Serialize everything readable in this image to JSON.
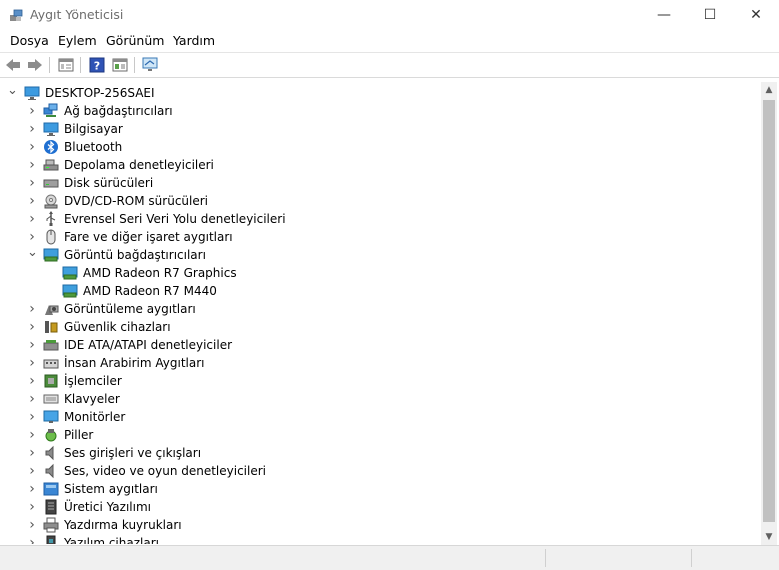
{
  "window": {
    "title": "Aygıt Yöneticisi",
    "controls": {
      "minimize": "—",
      "maximize": "☐",
      "close": "✕"
    }
  },
  "menu": [
    "Dosya",
    "Eylem",
    "Görünüm",
    "Yardım"
  ],
  "toolbar": {
    "icons": [
      "back-arrow-icon",
      "forward-arrow-icon",
      "properties-icon",
      "help-icon",
      "view-icon",
      "scan-monitor-icon"
    ]
  },
  "tree": {
    "root": "DESKTOP-256SAEI",
    "items": [
      {
        "label": "Ağ bağdaştırıcıları",
        "icon": "network-adapter-icon",
        "expanded": false
      },
      {
        "label": "Bilgisayar",
        "icon": "computer-icon",
        "expanded": false
      },
      {
        "label": "Bluetooth",
        "icon": "bluetooth-icon",
        "expanded": false
      },
      {
        "label": "Depolama denetleyicileri",
        "icon": "storage-controller-icon",
        "expanded": false
      },
      {
        "label": "Disk sürücüleri",
        "icon": "disk-drive-icon",
        "expanded": false
      },
      {
        "label": "DVD/CD-ROM sürücüleri",
        "icon": "dvd-drive-icon",
        "expanded": false
      },
      {
        "label": "Evrensel Seri Veri Yolu denetleyicileri",
        "icon": "usb-icon",
        "expanded": false
      },
      {
        "label": "Fare ve diğer işaret aygıtları",
        "icon": "mouse-icon",
        "expanded": false
      },
      {
        "label": "Görüntü bağdaştırıcıları",
        "icon": "display-adapter-icon",
        "expanded": true,
        "children": [
          {
            "label": "AMD Radeon R7 Graphics",
            "icon": "display-adapter-icon"
          },
          {
            "label": "AMD Radeon R7 M440",
            "icon": "display-adapter-icon"
          }
        ]
      },
      {
        "label": "Görüntüleme aygıtları",
        "icon": "imaging-device-icon",
        "expanded": false
      },
      {
        "label": "Güvenlik cihazları",
        "icon": "security-device-icon",
        "expanded": false
      },
      {
        "label": "IDE ATA/ATAPI denetleyiciler",
        "icon": "ide-controller-icon",
        "expanded": false
      },
      {
        "label": "İnsan Arabirim Aygıtları",
        "icon": "hid-icon",
        "expanded": false
      },
      {
        "label": "İşlemciler",
        "icon": "processor-icon",
        "expanded": false
      },
      {
        "label": "Klavyeler",
        "icon": "keyboard-icon",
        "expanded": false
      },
      {
        "label": "Monitörler",
        "icon": "monitor-icon",
        "expanded": false
      },
      {
        "label": "Piller",
        "icon": "battery-icon",
        "expanded": false
      },
      {
        "label": "Ses girişleri ve çıkışları",
        "icon": "speaker-icon",
        "expanded": false
      },
      {
        "label": "Ses, video ve oyun denetleyicileri",
        "icon": "speaker-icon",
        "expanded": false
      },
      {
        "label": "Sistem aygıtları",
        "icon": "system-device-icon",
        "expanded": false
      },
      {
        "label": "Üretici Yazılımı",
        "icon": "firmware-icon",
        "expanded": false
      },
      {
        "label": "Yazdırma kuyrukları",
        "icon": "printer-icon",
        "expanded": false
      },
      {
        "label": "Yazılım cihazları",
        "icon": "software-device-icon",
        "expanded": false
      }
    ]
  },
  "colors": {
    "accent": "#0078d7",
    "chevron": "#555555",
    "scroll_thumb": "#c1c1c1"
  }
}
